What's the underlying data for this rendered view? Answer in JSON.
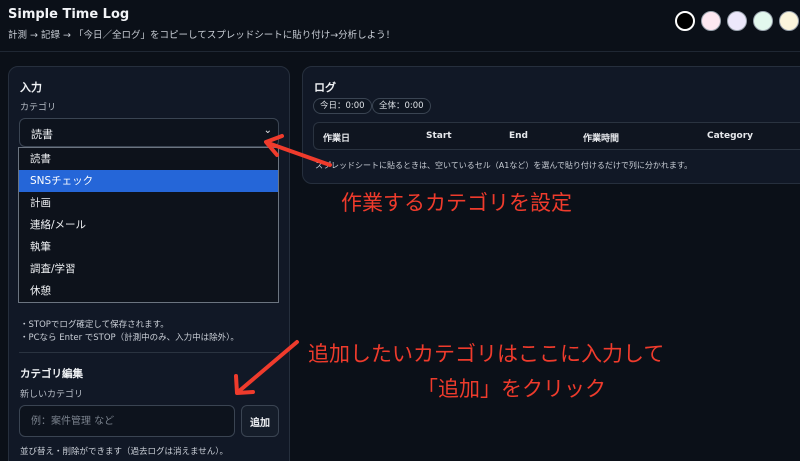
{
  "header": {
    "title": "Simple Time Log",
    "subtitle": "計測 → 記録 → 「今日／全ログ」をコピーしてスプレッドシートに貼り付け→分析しよう！",
    "theme_swatches": [
      {
        "name": "black",
        "color": "#000000",
        "active": true
      },
      {
        "name": "pink",
        "color": "#fde8f1",
        "active": false
      },
      {
        "name": "lavender",
        "color": "#ece8fb",
        "active": false
      },
      {
        "name": "mint",
        "color": "#e3f8ee",
        "active": false
      },
      {
        "name": "cream",
        "color": "#fbf5dc",
        "active": false
      }
    ]
  },
  "input_panel": {
    "title": "入力",
    "category_label": "カテゴリ",
    "selected_category": "読書",
    "dropdown_options": [
      "読書",
      "SNSチェック",
      "計画",
      "連絡/メール",
      "執筆",
      "調査/学習",
      "休憩"
    ],
    "highlighted_option": "SNSチェック",
    "notes": [
      "・STOPでログ確定して保存されます。",
      "・PCなら Enter でSTOP（計測中のみ、入力中は除外）。"
    ],
    "category_edit": {
      "title": "カテゴリ編集",
      "new_label": "新しいカテゴリ",
      "placeholder": "例：案件管理 など",
      "add_button": "追加",
      "footer": "並び替え・削除ができます（過去ログは消えません）。"
    }
  },
  "log_panel": {
    "title": "ログ",
    "today_pill": "今日：0:00",
    "total_pill": "全体：0:00",
    "columns": [
      "作業日",
      "Start",
      "End",
      "作業時間",
      "Category"
    ],
    "hint": "スプレッドシートに貼るときは、空いているセル（A1など）を選んで貼り付けるだけで列に分かれます。"
  },
  "annotations": {
    "category_note": "作業するカテゴリを設定",
    "add_note_line1": "追加したいカテゴリはここに入力して",
    "add_note_line2": "「追加」をクリック",
    "color": "#ef3b2c"
  }
}
